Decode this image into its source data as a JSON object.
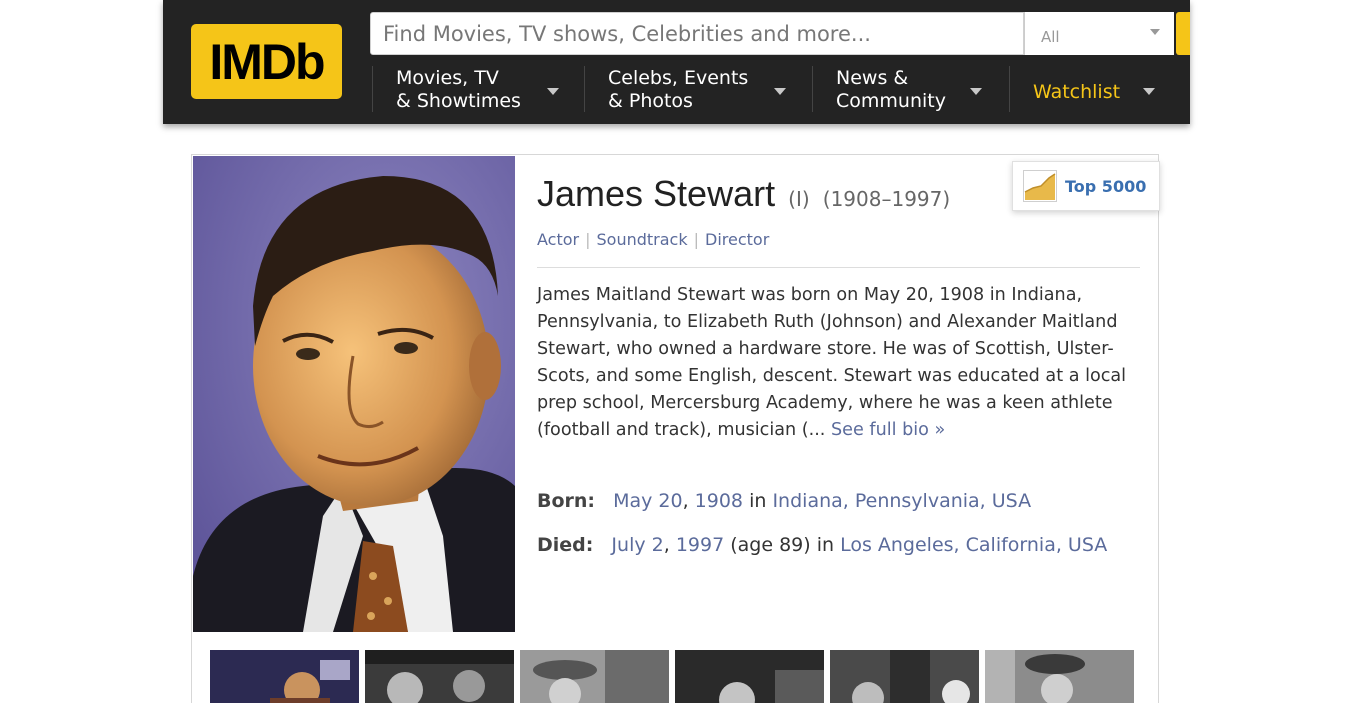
{
  "header": {
    "logo_text": "IMDb",
    "search": {
      "placeholder": "Find Movies, TV shows, Celebrities and more...",
      "category": "All"
    },
    "nav": [
      {
        "line1": "Movies, TV",
        "line2": "& Showtimes"
      },
      {
        "line1": "Celebs, Events",
        "line2": "& Photos"
      },
      {
        "line1": "News &",
        "line2": "Community"
      }
    ],
    "watchlist_label": "Watchlist"
  },
  "person": {
    "name": "James Stewart",
    "disambiguation": "(I)",
    "years": "(1908–1997)",
    "roles": [
      "Actor",
      "Soundtrack",
      "Director"
    ],
    "bio": "James Maitland Stewart was born on May 20, 1908 in Indiana, Pennsylvania, to Elizabeth Ruth (Johnson) and Alexander Maitland Stewart, who owned a hardware store. He was of Scottish, Ulster-Scots, and some English, descent. Stewart was educated at a local prep school, Mercersburg Academy, where he was a keen athlete (football and track), musician (...",
    "see_full_bio": "See full bio »",
    "born": {
      "label": "Born:",
      "date_md": "May 20",
      "date_sep": ",",
      "date_year": "1908",
      "connector": "in",
      "place": "Indiana, Pennsylvania, USA"
    },
    "died": {
      "label": "Died:",
      "date_md": "July 2",
      "date_sep": ",",
      "date_year": "1997",
      "age": "(age 89)",
      "connector": "in",
      "place": "Los Angeles, California, USA"
    },
    "rank_badge": "Top 5000"
  },
  "colors": {
    "brand": "#f5c518",
    "header_bg": "#232323",
    "link": "#5b6b9b"
  }
}
